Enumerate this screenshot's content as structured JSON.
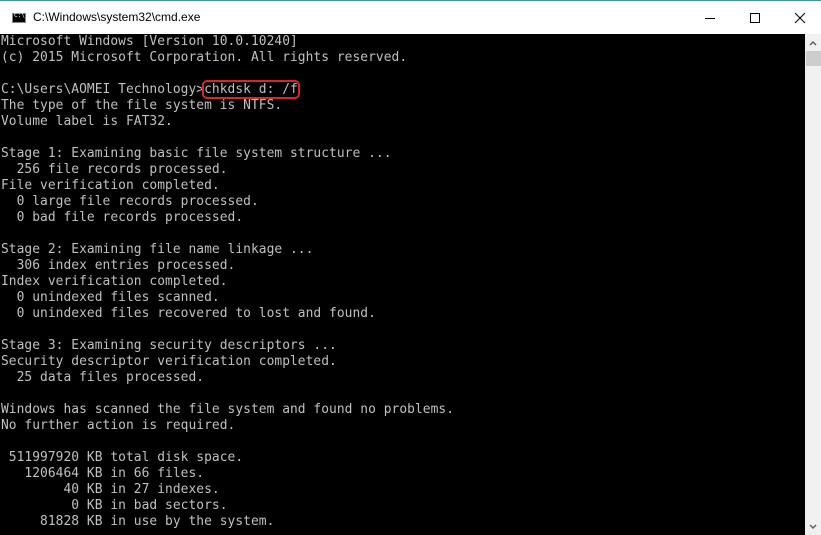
{
  "window": {
    "title": "C:\\Windows\\system32\\cmd.exe",
    "icon": "cmd-icon",
    "controls": {
      "minimize": "minimize-icon",
      "maximize": "maximize-icon",
      "close": "close-icon"
    }
  },
  "console": {
    "prompt": "C:\\Users\\AOMEI Technology>",
    "command": "chkdsk d: /f",
    "highlight_color": "#d8262b",
    "lines_before": [
      "Microsoft Windows [Version 10.0.10240]",
      "(c) 2015 Microsoft Corporation. All rights reserved.",
      ""
    ],
    "lines_after": [
      "The type of the file system is NTFS.",
      "Volume label is FAT32.",
      "",
      "Stage 1: Examining basic file system structure ...",
      "  256 file records processed.",
      "File verification completed.",
      "  0 large file records processed.",
      "  0 bad file records processed.",
      "",
      "Stage 2: Examining file name linkage ...",
      "  306 index entries processed.",
      "Index verification completed.",
      "  0 unindexed files scanned.",
      "  0 unindexed files recovered to lost and found.",
      "",
      "Stage 3: Examining security descriptors ...",
      "Security descriptor verification completed.",
      "  25 data files processed.",
      "",
      "Windows has scanned the file system and found no problems.",
      "No further action is required.",
      "",
      " 511997920 KB total disk space.",
      "   1206464 KB in 66 files.",
      "        40 KB in 27 indexes.",
      "         0 KB in bad sectors.",
      "     81828 KB in use by the system."
    ]
  }
}
